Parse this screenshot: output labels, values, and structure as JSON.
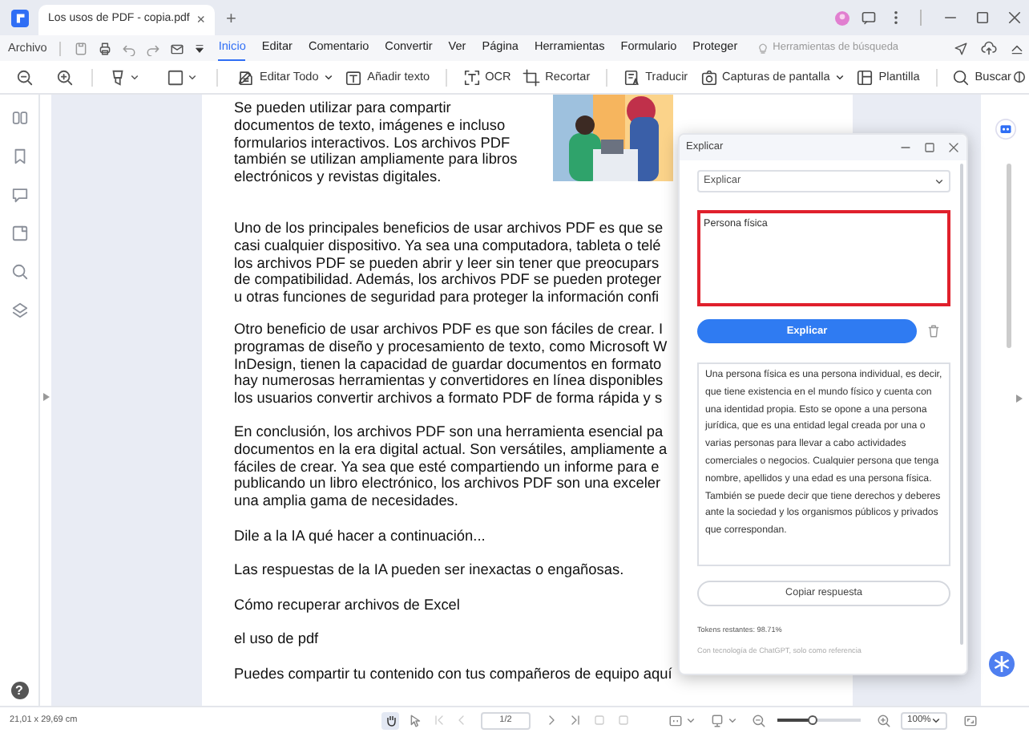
{
  "app_tab": {
    "title": "Los usos de PDF - copia.pdf",
    "close": "×"
  },
  "new_tab": "+",
  "menu": {
    "file": "Archivo",
    "tabs": [
      {
        "label": "Inicio",
        "selected": true
      },
      {
        "label": "Editar",
        "selected": false
      },
      {
        "label": "Comentario",
        "selected": false
      },
      {
        "label": "Convertir",
        "selected": false
      },
      {
        "label": "Ver",
        "selected": false
      },
      {
        "label": "Página",
        "selected": false
      },
      {
        "label": "Herramientas",
        "selected": false
      },
      {
        "label": "Formulario",
        "selected": false
      },
      {
        "label": "Proteger",
        "selected": false
      }
    ],
    "search_tools": "Herramientas de búsqueda"
  },
  "toolbar": [
    {
      "label": "Editar Todo",
      "dropdown": true
    },
    {
      "label": "Añadir texto",
      "dropdown": false
    },
    {
      "label": "OCR",
      "dropdown": false
    },
    {
      "label": "Recortar",
      "dropdown": false
    },
    {
      "label": "Traducir",
      "dropdown": false
    },
    {
      "label": "Capturas de pantalla",
      "dropdown": true
    },
    {
      "label": "Plantilla",
      "dropdown": false
    },
    {
      "label": "Buscar",
      "dropdown": false
    }
  ],
  "document": {
    "paragraphs": [
      {
        "lines": [
          "Se pueden utilizar para compartir",
          "documentos de texto, imágenes e incluso",
          "formularios interactivos. Los archivos PDF",
          "también se utilizan ampliamente para libros",
          "electrónicos y revistas digitales."
        ]
      },
      {
        "lines": [
          "Uno de los principales beneficios de usar archivos PDF es que se",
          "casi cualquier dispositivo. Ya sea una computadora, tableta o telé",
          "los archivos PDF se pueden abrir y leer sin tener que preocupars",
          "de compatibilidad. Además, los archivos PDF se pueden proteger",
          "u otras funciones de seguridad para proteger la información confi"
        ]
      },
      {
        "lines": [
          "Otro beneficio de usar archivos PDF es que son fáciles de crear. I",
          "programas de diseño y procesamiento de texto, como Microsoft W",
          "InDesign, tienen la capacidad de guardar documentos en formato",
          "hay numerosas herramientas y convertidores en línea disponibles",
          "los usuarios convertir archivos a formato PDF de forma rápida y s"
        ]
      },
      {
        "lines": [
          "En conclusión, los archivos PDF son una herramienta esencial pa",
          "documentos en la era digital actual. Son versátiles, ampliamente a",
          "fáciles de crear. Ya sea que esté compartiendo un informe para e",
          "publicando un libro electrónico, los archivos PDF son una exceler",
          "una amplia gama de necesidades."
        ]
      },
      {
        "lines": [
          "Dile a la IA qué hacer a continuación..."
        ]
      },
      {
        "lines": [
          "Las respuestas de la IA pueden ser inexactas o engañosas."
        ]
      },
      {
        "lines": [
          "Cómo recuperar archivos de Excel"
        ]
      },
      {
        "lines": [
          "el uso de pdf"
        ]
      },
      {
        "lines": [
          "Puedes compartir tu contenido con tus compañeros de equipo aquí"
        ]
      }
    ]
  },
  "dialog": {
    "title": "Explicar",
    "mode": "Explicar",
    "input": "Persona física",
    "submit": "Explicar",
    "answer": "Una persona física es una persona individual, es decir, que tiene existencia en el mundo físico y cuenta con una identidad propia. Esto se opone a una persona jurídica, que es una entidad legal creada por una o varias personas para llevar a cabo actividades comerciales o negocios. Cualquier persona que tenga nombre, apellidos y una edad es una persona física. También se puede decir que tiene derechos y deberes ante la sociedad y los organismos públicos y privados que correspondan.",
    "copy": "Copiar respuesta",
    "tokens": "Tokens restantes: 98.71%",
    "footer": "Con tecnología de ChatGPT, solo como referencia"
  },
  "help": "?",
  "status": {
    "page_size": "21,01 x 29,69 cm",
    "page": "1/2",
    "zoom_slider": {
      "level": 0.42
    },
    "zoom": "100%"
  }
}
